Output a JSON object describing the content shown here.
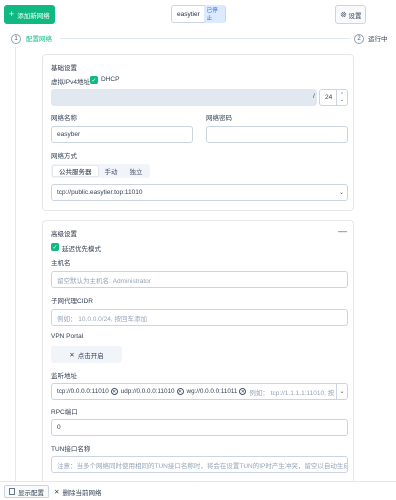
{
  "header": {
    "add_network_label": "添加新网络",
    "network_name": "easytier",
    "status_badge": "已停止",
    "settings_label": "设置"
  },
  "steps": [
    {
      "number": "1",
      "label": "配置网络"
    },
    {
      "number": "2",
      "label": "运行中"
    }
  ],
  "basic": {
    "title": "基础设置",
    "ipv4_label": "虚拟IPv4地址",
    "dhcp_label": "DHCP",
    "dhcp_checked": true,
    "ipv4_value": "",
    "prefix_separator": "/",
    "prefix_value": "24",
    "network_name_label": "网络名称",
    "network_name_value": "easyber",
    "network_secret_label": "网络密码",
    "network_secret_value": "",
    "mode_label": "网络方式",
    "modes": [
      "公共服务器",
      "手动",
      "独立"
    ],
    "selected_mode": "公共服务器",
    "server_value": "tcp://public.easytier.top:11010"
  },
  "advanced": {
    "title": "高级设置",
    "collapse_icon": "minus-icon",
    "latency_first_label": "延迟优先模式",
    "latency_first_checked": true,
    "hostname_label": "主机名",
    "hostname_placeholder": "留空默认为主机名: Administrator",
    "proxy_cidr_label": "子网代理CIDR",
    "proxy_cidr_placeholder": "例如： 10.0.0.0/24, 按回车添加",
    "vpn_portal_label": "VPN Portal",
    "vpn_portal_button": "点击开启",
    "listener_label": "监听地址",
    "listeners": [
      "tcp://0.0.0.0:11010",
      "udp://0.0.0.0:11010",
      "wg://0.0.0.0:11011"
    ],
    "listener_placeholder": "例如： tcp://1.1.1.1:11010, 按",
    "rpc_port_label": "RPC端口",
    "rpc_port_value": "0",
    "tun_name_label": "TUN接口名称",
    "tun_name_placeholder": "注意：当多个网络同时使用相同的TUN接口名称时，将会在设置TUN的IP时产生冲突，留空以自动生成随机名称"
  },
  "footer": {
    "show_config_label": "显示配置",
    "delete_network_label": "删除当前网络"
  },
  "colors": {
    "accent_green": "#10b981",
    "badge_blue": "#2563eb"
  }
}
